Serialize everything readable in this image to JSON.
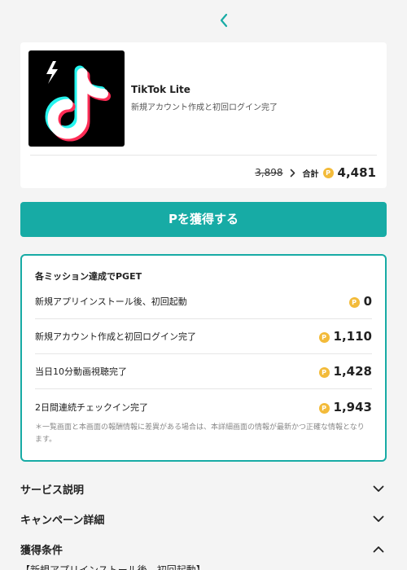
{
  "header": {
    "back_icon": "chevron-left-icon"
  },
  "app": {
    "name": "TikTok Lite",
    "subtitle": "新規アカウント作成と初回ログイン完了",
    "old_price": "3,898",
    "total_label": "合計",
    "coin_symbol": "P",
    "total_value": "4,481"
  },
  "cta": {
    "label": "Pを獲得する"
  },
  "missions": {
    "title": "各ミッション達成でPGET",
    "coin_symbol": "P",
    "items": [
      {
        "label": "新規アプリインストール後、初回起動",
        "points": "0"
      },
      {
        "label": "新規アカウント作成と初回ログイン完了",
        "points": "1,110"
      },
      {
        "label": "当日10分動画視聴完了",
        "points": "1,428"
      },
      {
        "label": "2日間連続チェックイン完了",
        "points": "1,943"
      }
    ],
    "note": "＊一覧画面と本画面の報酬情報に差異がある場合は、本詳細画面の情報が最新かつ正確な情報となります。"
  },
  "accordions": [
    {
      "label": "サービス説明",
      "state": "collapsed"
    },
    {
      "label": "キャンペーン詳細",
      "state": "collapsed"
    },
    {
      "label": "獲得条件",
      "state": "expanded"
    }
  ],
  "conditions": {
    "first_line": "【新規アプリインストール後、初回起動】"
  },
  "colors": {
    "accent": "#17aba5",
    "coin": "#f3bb3a",
    "background": "#f4f4f4"
  }
}
